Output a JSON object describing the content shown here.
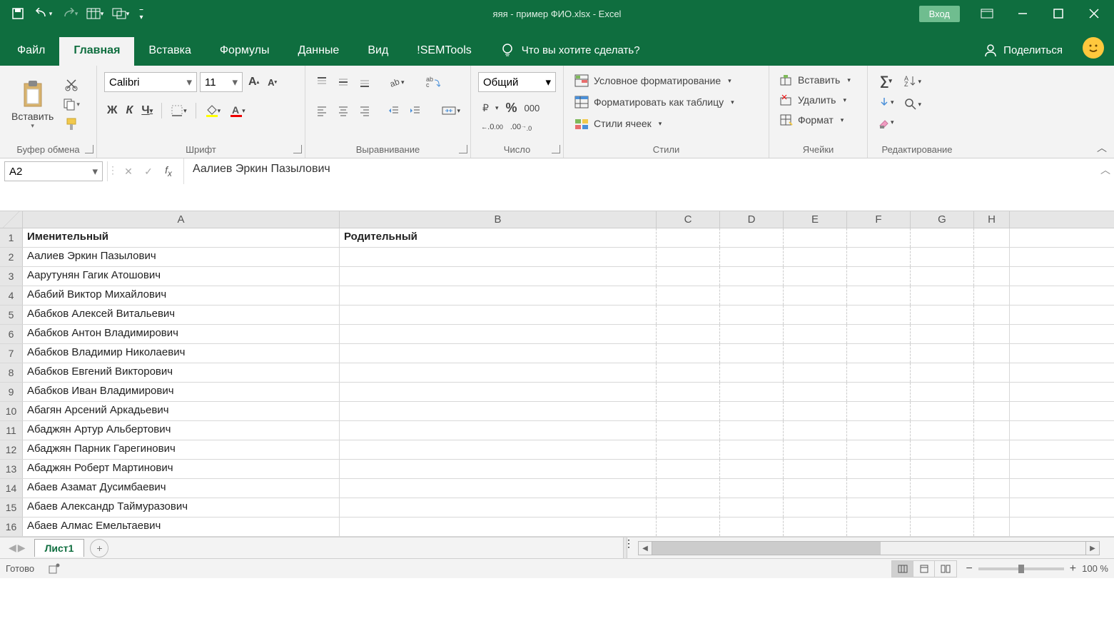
{
  "title": "яяя - пример ФИО.xlsx  -  Excel",
  "login_btn": "Вход",
  "tabs": [
    "Файл",
    "Главная",
    "Вставка",
    "Формулы",
    "Данные",
    "Вид",
    "!SEMTools"
  ],
  "active_tab": 1,
  "tellme": "Что вы хотите сделать?",
  "share": "Поделиться",
  "ribbon": {
    "clipboard": {
      "paste": "Вставить",
      "label": "Буфер обмена"
    },
    "font": {
      "name": "Calibri",
      "size": "11",
      "bold": "Ж",
      "italic": "К",
      "underline": "Ч",
      "label": "Шрифт"
    },
    "align": {
      "label": "Выравнивание"
    },
    "number": {
      "format": "Общий",
      "label": "Число"
    },
    "styles": {
      "cond": "Условное форматирование",
      "table": "Форматировать как таблицу",
      "cell": "Стили ячеек",
      "label": "Стили"
    },
    "cells": {
      "insert": "Вставить",
      "delete": "Удалить",
      "format": "Формат",
      "label": "Ячейки"
    },
    "editing": {
      "label": "Редактирование"
    }
  },
  "namebox": "A2",
  "formula": "Аалиев Эркин Пазылович",
  "columns": [
    "A",
    "B",
    "C",
    "D",
    "E",
    "F",
    "G",
    "H"
  ],
  "headers": {
    "A": "Именительный",
    "B": "Родительный"
  },
  "rows": [
    "Аалиев Эркин Пазылович",
    "Аарутунян Гагик Атошович",
    "Абабий Виктор Михайлович",
    "Абабков Алексей Витальевич",
    "Абабков Антон Владимирович",
    "Абабков Владимир Николаевич",
    "Абабков Евгений Викторович",
    "Абабков Иван Владимирович",
    "Абагян Арсений Аркадьевич",
    "Абаджян Артур Альбертович",
    "Абаджян Парник Гарегинович",
    "Абаджян Роберт Мартинович",
    "Абаев Азамат Дусимбаевич",
    "Абаев Александр Таймуразович",
    "Абаев Алмас Емельтаевич"
  ],
  "sheet_tab": "Лист1",
  "status": "Готово",
  "zoom": "100 %"
}
